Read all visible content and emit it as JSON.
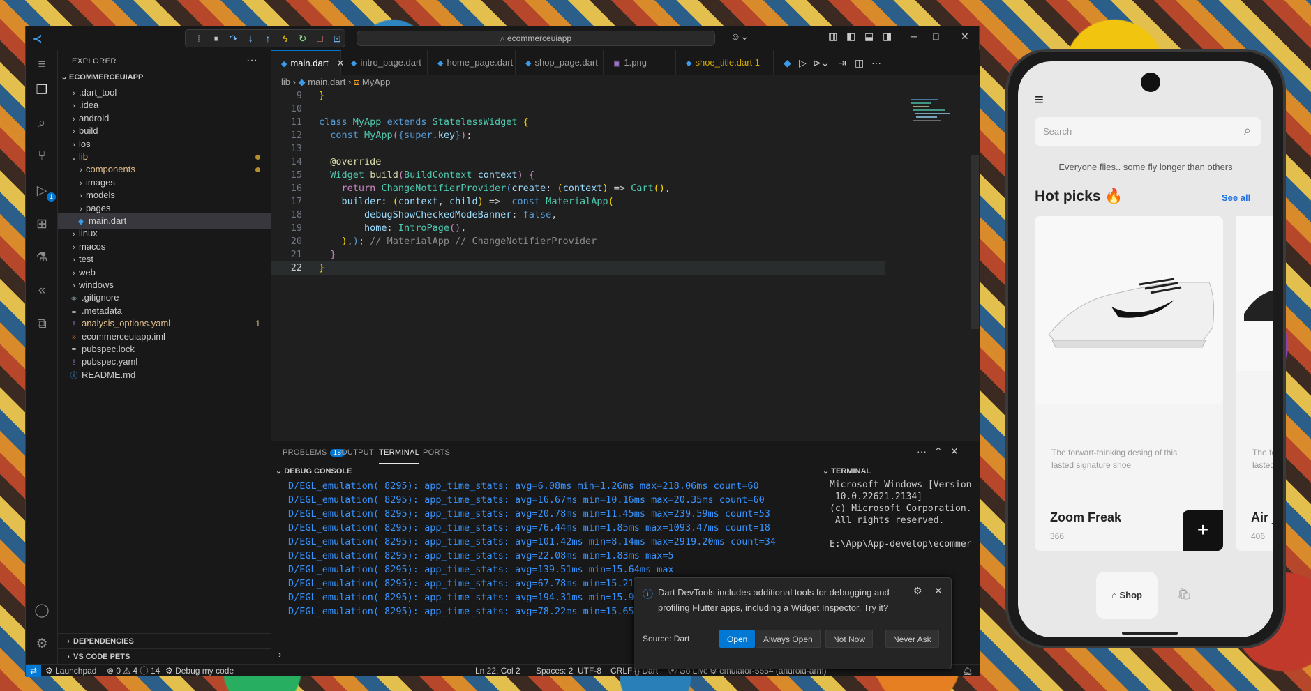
{
  "window": {
    "search": "ecommerceuiapp"
  },
  "explorer": {
    "title": "EXPLORER",
    "root": "ECOMMERCEUIAPP",
    "items": [
      ".dart_tool",
      ".idea",
      "android",
      "build",
      "ios",
      "lib",
      "components",
      "images",
      "models",
      "pages",
      "main.dart",
      "linux",
      "macos",
      "test",
      "web",
      "windows",
      ".gitignore",
      ".metadata",
      "analysis_options.yaml",
      "ecommerceuiapp.iml",
      "pubspec.lock",
      "pubspec.yaml",
      "README.md"
    ],
    "analysis_count": "1",
    "dependencies": "DEPENDENCIES",
    "pets": "VS CODE PETS"
  },
  "activity": {
    "run_badge": "1"
  },
  "tabs": [
    "main.dart",
    "intro_page.dart",
    "home_page.dart",
    "shop_page.dart",
    "1.png",
    "shoe_title.dart 1"
  ],
  "breadcrumb": {
    "lib": "lib",
    "file": "main.dart",
    "symbol": "MyApp"
  },
  "code": {
    "line_numbers": [
      "9",
      "10",
      "11",
      "12",
      "13",
      "14",
      "15",
      "16",
      "17",
      "18",
      "19",
      "20",
      "21",
      "22"
    ]
  },
  "panel": {
    "tabs": {
      "problems": "PROBLEMS",
      "problems_count": "18",
      "output": "OUTPUT",
      "terminal": "TERMINAL",
      "ports": "PORTS"
    },
    "debug_title": "DEBUG CONSOLE",
    "terminal_title": "TERMINAL",
    "debug_lines": [
      "D/EGL_emulation( 8295): app_time_stats: avg=6.08ms min=1.26ms max=218.06ms count=60",
      "D/EGL_emulation( 8295): app_time_stats: avg=16.67ms min=10.16ms max=20.35ms count=60",
      "D/EGL_emulation( 8295): app_time_stats: avg=20.78ms min=11.45ms max=239.59ms count=53",
      "D/EGL_emulation( 8295): app_time_stats: avg=76.44ms min=1.85ms max=1093.47ms count=18",
      "D/EGL_emulation( 8295): app_time_stats: avg=101.42ms min=8.14ms max=2919.20ms count=34",
      "D/EGL_emulation( 8295): app_time_stats: avg=22.08ms min=1.83ms max=5",
      "D/EGL_emulation( 8295): app_time_stats: avg=139.51ms min=15.64ms max",
      "D/EGL_emulation( 8295): app_time_stats: avg=67.78ms min=15.21ms max",
      "D/EGL_emulation( 8295): app_time_stats: avg=194.31ms min=15.93ms max",
      "D/EGL_emulation( 8295): app_time_stats: avg=78.22ms min=15.65ms max"
    ],
    "terminal_lines": [
      "Microsoft Windows [Version",
      " 10.0.22621.2134]",
      "(c) Microsoft Corporation.",
      " All rights reserved.",
      "",
      "E:\\App\\App-develop\\ecommer"
    ]
  },
  "notification": {
    "text1": "Dart DevTools includes additional tools for debugging and",
    "text2": "profiling Flutter apps, including a Widget Inspector. Try it?",
    "source": "Source: Dart",
    "open": "Open",
    "always": "Always Open",
    "notnow": "Not Now",
    "never": "Never Ask"
  },
  "statusbar": {
    "launchpad": "Launchpad",
    "errors": "0",
    "warnings": "4",
    "infos": "14",
    "debug": "Debug my code",
    "position": "Ln 22, Col 2",
    "spaces": "Spaces: 2",
    "encoding": "UTF-8",
    "eol": "CRLF",
    "lang": "Dart",
    "golive": "Go Live",
    "device": "emulator-5554 (android-arm)"
  },
  "phone": {
    "search_placeholder": "Search",
    "tagline": "Everyone flies.. some fly longer than others",
    "hot_picks": "Hot picks 🔥",
    "see_all": "See all",
    "card1": {
      "desc1": "The forwart-thinking desing of this",
      "desc2": "lasted signature shoe",
      "name": "Zoom Freak",
      "price": "366"
    },
    "card2": {
      "desc1": "The fo",
      "desc2": "lasted",
      "name": "Air j",
      "price": "406"
    },
    "nav_shop": "Shop"
  },
  "colors": {
    "accent": "#0078d4",
    "debug_text": "#3794ff",
    "editor_bg": "#1f1f1f"
  }
}
